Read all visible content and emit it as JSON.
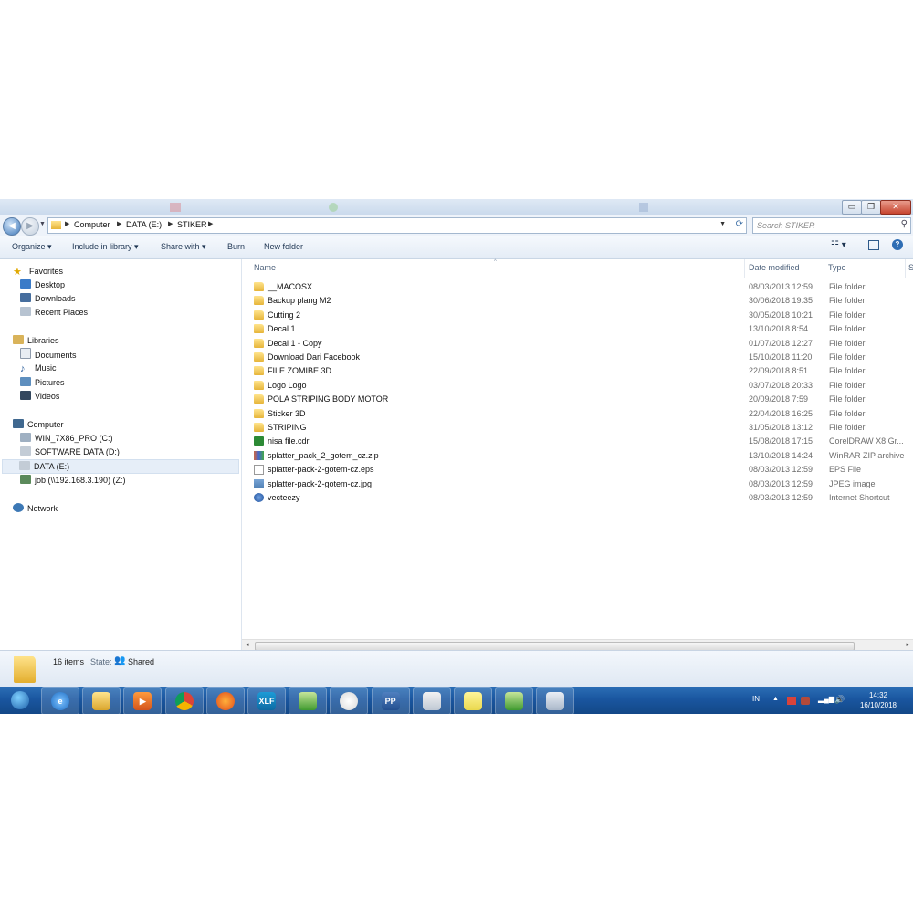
{
  "window": {
    "breadcrumbs": [
      "Computer",
      "DATA (E:)",
      "STIKER"
    ],
    "search_placeholder": "Search STIKER",
    "minimize_glyph": "▭",
    "maximize_glyph": "❐",
    "close_glyph": "✕"
  },
  "toolbar": {
    "organize": "Organize ▾",
    "include_in_library": "Include in library ▾",
    "share_with": "Share with ▾",
    "burn": "Burn",
    "new_folder": "New folder"
  },
  "nav": {
    "favorites": {
      "label": "Favorites",
      "items": [
        "Desktop",
        "Downloads",
        "Recent Places"
      ]
    },
    "libraries": {
      "label": "Libraries",
      "items": [
        "Documents",
        "Music",
        "Pictures",
        "Videos"
      ]
    },
    "computer": {
      "label": "Computer",
      "items": [
        "WIN_7X86_PRO (C:)",
        "SOFTWARE DATA  (D:)",
        "DATA  (E:)",
        "job (\\\\192.168.3.190) (Z:)"
      ]
    },
    "network": {
      "label": "Network"
    }
  },
  "columns": {
    "name": "Name",
    "date": "Date modified",
    "type": "Type",
    "size": "S"
  },
  "files": [
    {
      "name": "__MACOSX",
      "date": "08/03/2013 12:59",
      "type": "File folder",
      "icon": "folder-icon"
    },
    {
      "name": "Backup plang M2",
      "date": "30/06/2018 19:35",
      "type": "File folder",
      "icon": "folder-icon"
    },
    {
      "name": "Cutting 2",
      "date": "30/05/2018 10:21",
      "type": "File folder",
      "icon": "folder-icon"
    },
    {
      "name": "Decal 1",
      "date": "13/10/2018 8:54",
      "type": "File folder",
      "icon": "folder-icon"
    },
    {
      "name": "Decal 1 - Copy",
      "date": "01/07/2018 12:27",
      "type": "File folder",
      "icon": "folder-icon"
    },
    {
      "name": "Download Dari Facebook",
      "date": "15/10/2018 11:20",
      "type": "File folder",
      "icon": "folder-icon"
    },
    {
      "name": "FILE ZOMIBE 3D",
      "date": "22/09/2018 8:51",
      "type": "File folder",
      "icon": "folder-icon"
    },
    {
      "name": "Logo Logo",
      "date": "03/07/2018 20:33",
      "type": "File folder",
      "icon": "folder-icon"
    },
    {
      "name": "POLA STRIPING BODY MOTOR",
      "date": "20/09/2018 7:59",
      "type": "File folder",
      "icon": "folder-icon"
    },
    {
      "name": "Sticker 3D",
      "date": "22/04/2018 16:25",
      "type": "File folder",
      "icon": "folder-icon"
    },
    {
      "name": "STRIPING",
      "date": "31/05/2018 13:12",
      "type": "File folder",
      "icon": "folder-icon"
    },
    {
      "name": "nisa file.cdr",
      "date": "15/08/2018 17:15",
      "type": "CorelDRAW X8 Gr...",
      "icon": "coreldraw-icon"
    },
    {
      "name": "splatter_pack_2_gotem_cz.zip",
      "date": "13/10/2018 14:24",
      "type": "WinRAR ZIP archive",
      "icon": "zip-icon"
    },
    {
      "name": "splatter-pack-2-gotem-cz.eps",
      "date": "08/03/2013 12:59",
      "type": "EPS File",
      "icon": "eps-file-icon"
    },
    {
      "name": "splatter-pack-2-gotem-cz.jpg",
      "date": "08/03/2013 12:59",
      "type": "JPEG image",
      "icon": "jpeg-icon"
    },
    {
      "name": "vecteezy",
      "date": "08/03/2013 12:59",
      "type": "Internet Shortcut",
      "icon": "internet-shortcut-icon"
    }
  ],
  "status": {
    "items": "16 items",
    "state_label": "State:",
    "state_value": "Shared"
  },
  "taskbar": {
    "apps": [
      "start-orb",
      "internet-explorer",
      "file-explorer",
      "media-player",
      "chrome",
      "firefox",
      "xlf",
      "coreldraw",
      "cc-app",
      "pp-app",
      "window-app",
      "sticky-notes",
      "coreldraw-2",
      "calculator"
    ],
    "xlf_label": "XLF",
    "pp_label": "PP",
    "lang": "IN",
    "time": "14:32",
    "date": "16/10/2018"
  }
}
